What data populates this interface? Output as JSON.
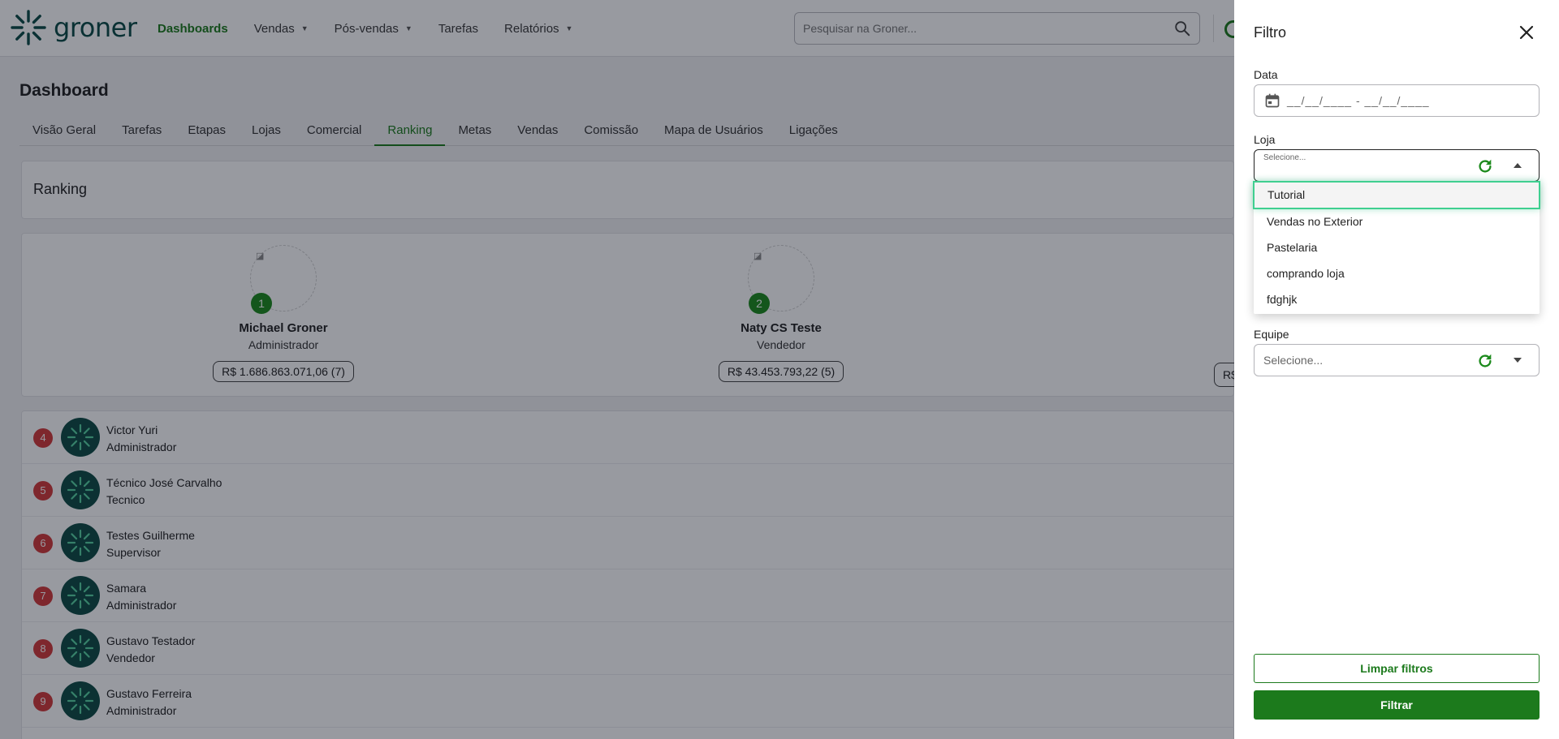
{
  "header": {
    "logo_text": "groner",
    "nav": [
      {
        "label": "Dashboards",
        "active": true,
        "has_caret": false
      },
      {
        "label": "Vendas",
        "active": false,
        "has_caret": true
      },
      {
        "label": "Pós-vendas",
        "active": false,
        "has_caret": true
      },
      {
        "label": "Tarefas",
        "active": false,
        "has_caret": false
      },
      {
        "label": "Relatórios",
        "active": false,
        "has_caret": true
      }
    ],
    "search_placeholder": "Pesquisar na Groner..."
  },
  "page": {
    "title": "Dashboard",
    "tabs": [
      "Visão Geral",
      "Tarefas",
      "Etapas",
      "Lojas",
      "Comercial",
      "Ranking",
      "Metas",
      "Vendas",
      "Comissão",
      "Mapa de Usuários",
      "Ligações"
    ],
    "active_tab": "Ranking",
    "section_title": "Ranking",
    "podium": [
      {
        "rank": "1",
        "name": "Michael Groner",
        "role": "Administrador",
        "value": "R$ 1.686.863.071,06 (7)"
      },
      {
        "rank": "2",
        "name": "Naty CS Teste",
        "role": "Vendedor",
        "value": "R$ 43.453.793,22 (5)"
      }
    ],
    "podium_third_partial": "R$",
    "list": [
      {
        "rank": "4",
        "name": "Victor Yuri",
        "role": "Administrador"
      },
      {
        "rank": "5",
        "name": "Técnico José Carvalho",
        "role": "Tecnico"
      },
      {
        "rank": "6",
        "name": "Testes Guilherme",
        "role": "Supervisor"
      },
      {
        "rank": "7",
        "name": "Samara",
        "role": "Administrador"
      },
      {
        "rank": "8",
        "name": "Gustavo Testador",
        "role": "Vendedor"
      },
      {
        "rank": "9",
        "name": "Gustavo Ferreira",
        "role": "Administrador"
      }
    ]
  },
  "drawer": {
    "title": "Filtro",
    "date_label": "Data",
    "date_placeholder": "__/__/____ - __/__/____",
    "loja_label": "Loja",
    "loja_placeholder": "Selecione...",
    "loja_options": [
      "Tutorial",
      "Vendas no Exterior",
      "Pastelaria",
      "comprando loja",
      "fdghjk"
    ],
    "loja_highlighted": "Tutorial",
    "equipe_label": "Equipe",
    "equipe_placeholder": "Selecione...",
    "clear_label": "Limpar filtros",
    "filter_label": "Filtrar"
  },
  "colors": {
    "brand_green": "#1c7a1c",
    "logo_teal": "#0b4a45",
    "rank_red": "#d33a3a",
    "highlight": "#3fcf90"
  }
}
